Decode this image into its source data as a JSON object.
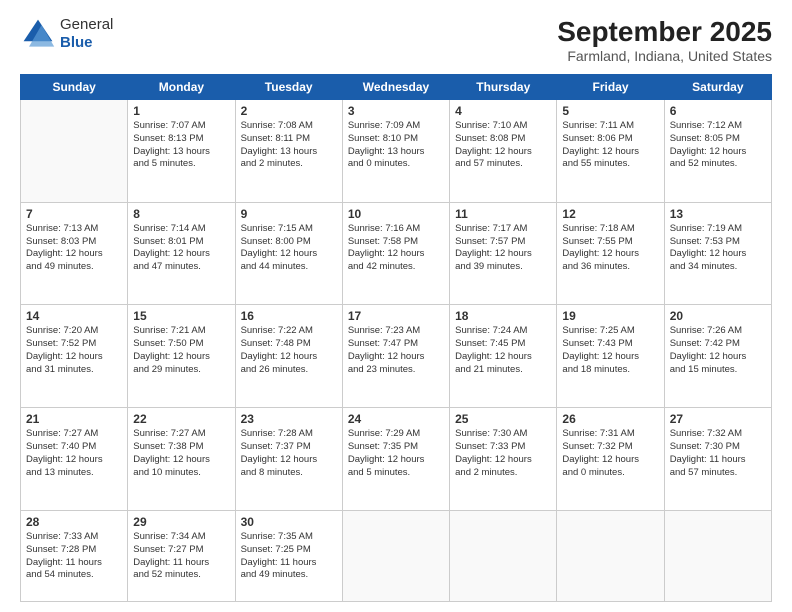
{
  "header": {
    "logo_line1": "General",
    "logo_line2": "Blue",
    "title": "September 2025",
    "subtitle": "Farmland, Indiana, United States"
  },
  "days_of_week": [
    "Sunday",
    "Monday",
    "Tuesday",
    "Wednesday",
    "Thursday",
    "Friday",
    "Saturday"
  ],
  "weeks": [
    [
      {
        "day": "",
        "content": ""
      },
      {
        "day": "1",
        "content": "Sunrise: 7:07 AM\nSunset: 8:13 PM\nDaylight: 13 hours\nand 5 minutes."
      },
      {
        "day": "2",
        "content": "Sunrise: 7:08 AM\nSunset: 8:11 PM\nDaylight: 13 hours\nand 2 minutes."
      },
      {
        "day": "3",
        "content": "Sunrise: 7:09 AM\nSunset: 8:10 PM\nDaylight: 13 hours\nand 0 minutes."
      },
      {
        "day": "4",
        "content": "Sunrise: 7:10 AM\nSunset: 8:08 PM\nDaylight: 12 hours\nand 57 minutes."
      },
      {
        "day": "5",
        "content": "Sunrise: 7:11 AM\nSunset: 8:06 PM\nDaylight: 12 hours\nand 55 minutes."
      },
      {
        "day": "6",
        "content": "Sunrise: 7:12 AM\nSunset: 8:05 PM\nDaylight: 12 hours\nand 52 minutes."
      }
    ],
    [
      {
        "day": "7",
        "content": "Sunrise: 7:13 AM\nSunset: 8:03 PM\nDaylight: 12 hours\nand 49 minutes."
      },
      {
        "day": "8",
        "content": "Sunrise: 7:14 AM\nSunset: 8:01 PM\nDaylight: 12 hours\nand 47 minutes."
      },
      {
        "day": "9",
        "content": "Sunrise: 7:15 AM\nSunset: 8:00 PM\nDaylight: 12 hours\nand 44 minutes."
      },
      {
        "day": "10",
        "content": "Sunrise: 7:16 AM\nSunset: 7:58 PM\nDaylight: 12 hours\nand 42 minutes."
      },
      {
        "day": "11",
        "content": "Sunrise: 7:17 AM\nSunset: 7:57 PM\nDaylight: 12 hours\nand 39 minutes."
      },
      {
        "day": "12",
        "content": "Sunrise: 7:18 AM\nSunset: 7:55 PM\nDaylight: 12 hours\nand 36 minutes."
      },
      {
        "day": "13",
        "content": "Sunrise: 7:19 AM\nSunset: 7:53 PM\nDaylight: 12 hours\nand 34 minutes."
      }
    ],
    [
      {
        "day": "14",
        "content": "Sunrise: 7:20 AM\nSunset: 7:52 PM\nDaylight: 12 hours\nand 31 minutes."
      },
      {
        "day": "15",
        "content": "Sunrise: 7:21 AM\nSunset: 7:50 PM\nDaylight: 12 hours\nand 29 minutes."
      },
      {
        "day": "16",
        "content": "Sunrise: 7:22 AM\nSunset: 7:48 PM\nDaylight: 12 hours\nand 26 minutes."
      },
      {
        "day": "17",
        "content": "Sunrise: 7:23 AM\nSunset: 7:47 PM\nDaylight: 12 hours\nand 23 minutes."
      },
      {
        "day": "18",
        "content": "Sunrise: 7:24 AM\nSunset: 7:45 PM\nDaylight: 12 hours\nand 21 minutes."
      },
      {
        "day": "19",
        "content": "Sunrise: 7:25 AM\nSunset: 7:43 PM\nDaylight: 12 hours\nand 18 minutes."
      },
      {
        "day": "20",
        "content": "Sunrise: 7:26 AM\nSunset: 7:42 PM\nDaylight: 12 hours\nand 15 minutes."
      }
    ],
    [
      {
        "day": "21",
        "content": "Sunrise: 7:27 AM\nSunset: 7:40 PM\nDaylight: 12 hours\nand 13 minutes."
      },
      {
        "day": "22",
        "content": "Sunrise: 7:27 AM\nSunset: 7:38 PM\nDaylight: 12 hours\nand 10 minutes."
      },
      {
        "day": "23",
        "content": "Sunrise: 7:28 AM\nSunset: 7:37 PM\nDaylight: 12 hours\nand 8 minutes."
      },
      {
        "day": "24",
        "content": "Sunrise: 7:29 AM\nSunset: 7:35 PM\nDaylight: 12 hours\nand 5 minutes."
      },
      {
        "day": "25",
        "content": "Sunrise: 7:30 AM\nSunset: 7:33 PM\nDaylight: 12 hours\nand 2 minutes."
      },
      {
        "day": "26",
        "content": "Sunrise: 7:31 AM\nSunset: 7:32 PM\nDaylight: 12 hours\nand 0 minutes."
      },
      {
        "day": "27",
        "content": "Sunrise: 7:32 AM\nSunset: 7:30 PM\nDaylight: 11 hours\nand 57 minutes."
      }
    ],
    [
      {
        "day": "28",
        "content": "Sunrise: 7:33 AM\nSunset: 7:28 PM\nDaylight: 11 hours\nand 54 minutes."
      },
      {
        "day": "29",
        "content": "Sunrise: 7:34 AM\nSunset: 7:27 PM\nDaylight: 11 hours\nand 52 minutes."
      },
      {
        "day": "30",
        "content": "Sunrise: 7:35 AM\nSunset: 7:25 PM\nDaylight: 11 hours\nand 49 minutes."
      },
      {
        "day": "",
        "content": ""
      },
      {
        "day": "",
        "content": ""
      },
      {
        "day": "",
        "content": ""
      },
      {
        "day": "",
        "content": ""
      }
    ]
  ]
}
